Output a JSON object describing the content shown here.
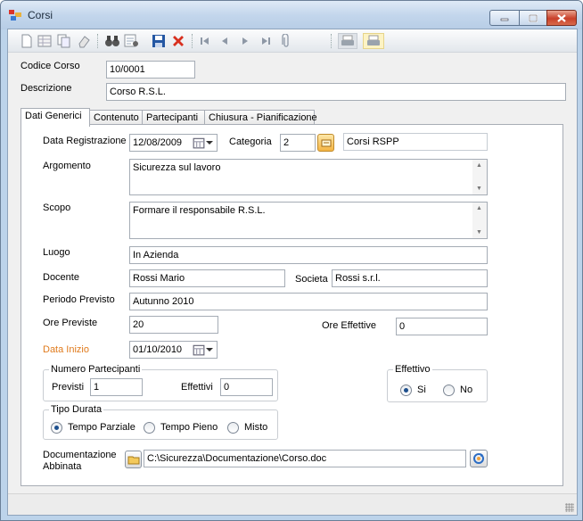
{
  "window": {
    "title": "Corsi"
  },
  "toolbar": {
    "icons": [
      "new-icon",
      "grid-icon",
      "copy-icon",
      "eraser-icon",
      "binoculars-icon",
      "find-record-icon",
      "save-icon",
      "delete-icon",
      "first-icon",
      "previous-icon",
      "next-icon",
      "last-icon",
      "attach-icon",
      "print-icon",
      "print-preview-icon"
    ]
  },
  "header": {
    "codice_label": "Codice Corso",
    "codice_value": "10/0001",
    "descrizione_label": "Descrizione",
    "descrizione_value": "Corso R.S.L."
  },
  "tabs": [
    {
      "label": "Dati Generici",
      "active": true
    },
    {
      "label": "Contenuto",
      "active": false
    },
    {
      "label": "Partecipanti",
      "active": false
    },
    {
      "label": "Chiusura - Pianificazione",
      "active": false
    }
  ],
  "form": {
    "data_registrazione_label": "Data Registrazione",
    "data_registrazione_value": "12/08/2009",
    "categoria_label": "Categoria",
    "categoria_code": "2",
    "categoria_name": "Corsi  RSPP",
    "argomento_label": "Argomento",
    "argomento_value": "Sicurezza sul lavoro",
    "scopo_label": "Scopo",
    "scopo_value": "Formare il responsabile R.S.L.",
    "luogo_label": "Luogo",
    "luogo_value": "In Azienda",
    "docente_label": "Docente",
    "docente_value": "Rossi Mario",
    "societa_label": "Societa",
    "societa_value": "Rossi s.r.l.",
    "periodo_label": "Periodo Previsto",
    "periodo_value": "Autunno 2010",
    "ore_previste_label": "Ore Previste",
    "ore_previste_value": "20",
    "ore_effettive_label": "Ore Effettive",
    "ore_effettive_value": "0",
    "data_inizio_label": "Data Inizio",
    "data_inizio_value": "01/10/2010",
    "data_inizio_color": "#e07b1d",
    "numero_partecipanti": {
      "title": "Numero Partecipanti",
      "previsti_label": "Previsti",
      "previsti_value": "1",
      "effettivi_label": "Effettivi",
      "effettivi_value": "0"
    },
    "effettivo": {
      "title": "Effettivo",
      "options": [
        {
          "label": "Si",
          "selected": true
        },
        {
          "label": "No",
          "selected": false
        }
      ]
    },
    "tipo_durata": {
      "title": "Tipo Durata",
      "options": [
        {
          "label": "Tempo Parziale",
          "selected": true
        },
        {
          "label": "Tempo Pieno",
          "selected": false
        },
        {
          "label": "Misto",
          "selected": false
        }
      ]
    },
    "documentazione_label_1": "Documentazione",
    "documentazione_label_2": "Abbinata",
    "documentazione_value": "C:\\Sicurezza\\Documentazione\\Corso.doc"
  },
  "colors": {
    "accent": "#1d4f8d",
    "titlebar": "#c3d6ec",
    "close": "#c9402a"
  }
}
